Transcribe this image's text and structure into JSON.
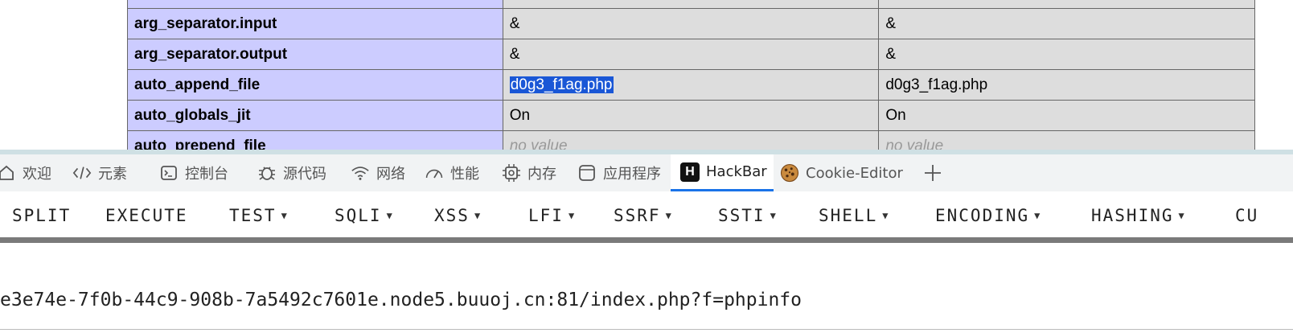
{
  "phpinfo": {
    "rows": [
      {
        "name": "arg_separator.input",
        "local": "&",
        "master": "&"
      },
      {
        "name": "arg_separator.output",
        "local": "&",
        "master": "&"
      },
      {
        "name": "auto_append_file",
        "local": "d0g3_f1ag.php",
        "master": "d0g3_f1ag.php"
      },
      {
        "name": "auto_globals_jit",
        "local": "On",
        "master": "On"
      },
      {
        "name": "auto_prepend_file",
        "local": "no value",
        "master": "no value"
      }
    ]
  },
  "devtools": {
    "tabs": [
      {
        "label": "欢迎",
        "icon": "home-icon"
      },
      {
        "label": "元素",
        "icon": "code-tag-icon"
      },
      {
        "label": "控制台",
        "icon": "console-icon"
      },
      {
        "label": "源代码",
        "icon": "bug-icon"
      },
      {
        "label": "网络",
        "icon": "wifi-icon"
      },
      {
        "label": "性能",
        "icon": "gauge-icon"
      },
      {
        "label": "内存",
        "icon": "chip-icon"
      },
      {
        "label": "应用程序",
        "icon": "app-window-icon"
      },
      {
        "label": "HackBar",
        "icon": "hackbar-logo-icon",
        "active": true
      },
      {
        "label": "Cookie-Editor",
        "icon": "cookie-icon"
      }
    ],
    "add_tab_icon": "plus-icon",
    "active_color": "#1a73e8"
  },
  "hackbar": {
    "buttons": [
      {
        "label": "SPLIT",
        "dropdown": false
      },
      {
        "label": "EXECUTE",
        "dropdown": false
      },
      {
        "label": "TEST",
        "dropdown": true
      },
      {
        "label": "SQLI",
        "dropdown": true
      },
      {
        "label": "XSS",
        "dropdown": true
      },
      {
        "label": "LFI",
        "dropdown": true
      },
      {
        "label": "SSRF",
        "dropdown": true
      },
      {
        "label": "SSTI",
        "dropdown": true
      },
      {
        "label": "SHELL",
        "dropdown": true
      },
      {
        "label": "ENCODING",
        "dropdown": true
      },
      {
        "label": "HASHING",
        "dropdown": true
      },
      {
        "label": "CU",
        "dropdown": false
      }
    ],
    "url": "e3e74e-7f0b-44c9-908b-7a5492c7601e.node5.buuoj.cn:81/index.php?f=phpinfo"
  }
}
